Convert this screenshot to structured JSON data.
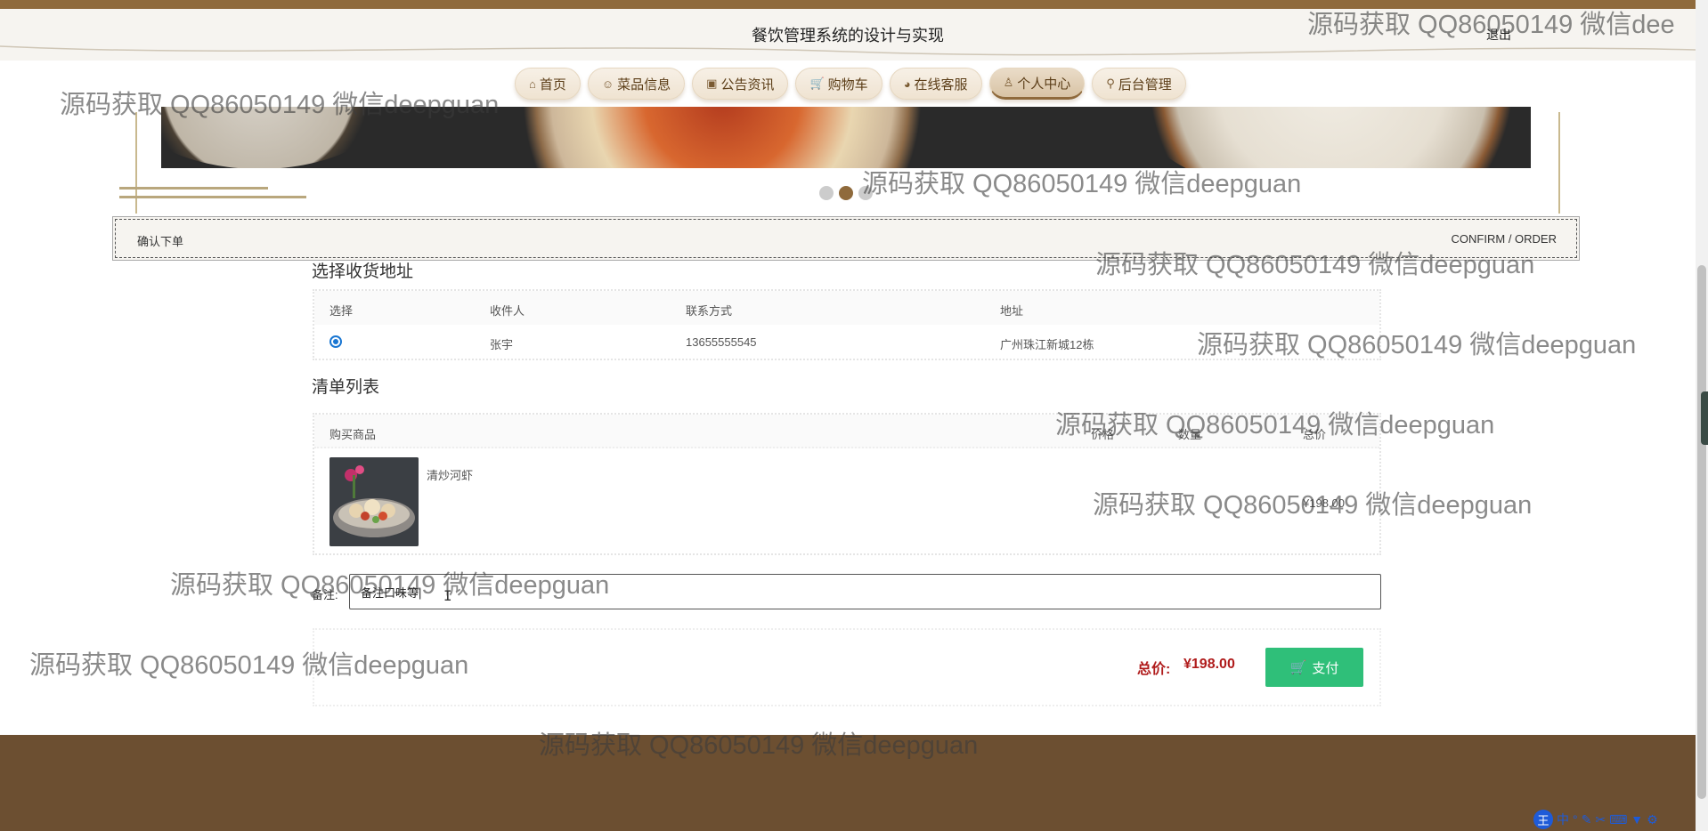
{
  "header": {
    "title": "餐饮管理系统的设计与实现",
    "logout_label": "退出"
  },
  "nav": {
    "items": [
      {
        "label": "首页",
        "icon": "home-icon",
        "glyph": "⌂"
      },
      {
        "label": "菜品信息",
        "icon": "dish-icon",
        "glyph": "☺"
      },
      {
        "label": "公告资讯",
        "icon": "gift-icon",
        "glyph": "▣"
      },
      {
        "label": "购物车",
        "icon": "cart-icon",
        "glyph": "🛒"
      },
      {
        "label": "在线客服",
        "icon": "chat-icon",
        "glyph": "◕"
      },
      {
        "label": "个人中心",
        "icon": "user-icon",
        "glyph": "♙"
      },
      {
        "label": "后台管理",
        "icon": "link-icon",
        "glyph": "⚲"
      }
    ],
    "active_index": 5
  },
  "carousel": {
    "dot_count": 3,
    "active_dot": 1
  },
  "section": {
    "left": "确认下单",
    "right": "CONFIRM / ORDER"
  },
  "address": {
    "title": "选择收货地址",
    "headers": {
      "select": "选择",
      "receiver": "收件人",
      "contact": "联系方式",
      "address": "地址"
    },
    "rows": [
      {
        "receiver": "张宇",
        "contact": "13655555545",
        "address": "广州珠江新城12栋",
        "selected": true
      }
    ]
  },
  "order": {
    "title": "清单列表",
    "headers": {
      "product": "购买商品",
      "price": "价格",
      "qty": "数量",
      "total": "总价"
    },
    "items": [
      {
        "name": "清炒河虾",
        "total": "¥198.00"
      }
    ]
  },
  "remark": {
    "label": "备注:",
    "value": "备注口味等|"
  },
  "summary": {
    "total_label": "总价:",
    "total_value": "¥198.00",
    "pay_label": "支付"
  },
  "watermark": {
    "text": "源码获取 QQ86050149 微信deepguan",
    "text_clipped": "源码获取 QQ86050149 微信dee"
  },
  "ime": {
    "logo": "王",
    "mode": "中"
  },
  "colors": {
    "brand_brown": "#8f6a3c",
    "footer_brown": "#6c4f31",
    "pay_green": "#2fbf79",
    "price_red": "#b01c1c",
    "radio_blue": "#1976d2"
  }
}
